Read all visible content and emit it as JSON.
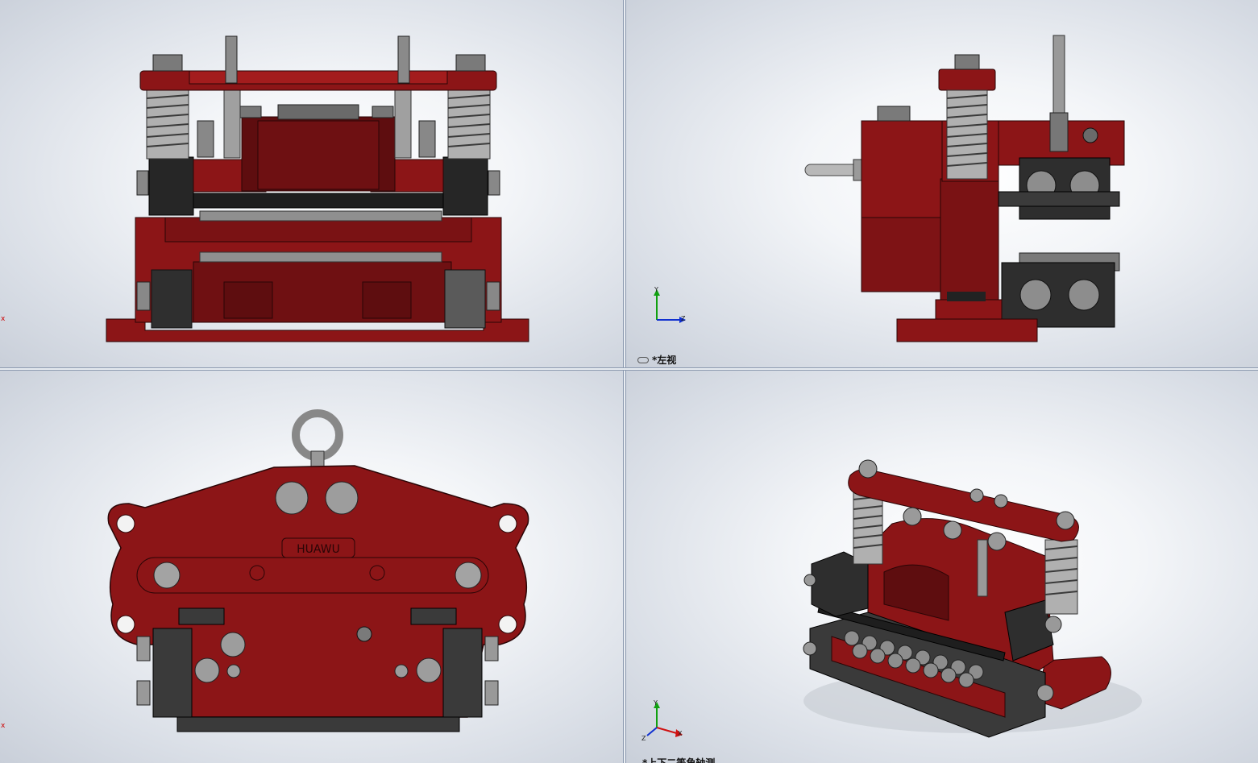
{
  "colors": {
    "part_red": "#8c1517",
    "part_red_dark": "#5e0d0f",
    "part_red_light": "#a8201f",
    "steel": "#9a9a9a",
    "steel_dark": "#4a4a4a",
    "block_dark": "#3a3a3a",
    "axis_x": "#d01010",
    "axis_y": "#10a010",
    "axis_z": "#1030d0"
  },
  "viewports": {
    "front": {
      "corner_mark": "x"
    },
    "left": {
      "view_label": "*左视",
      "label_icon": "link-icon",
      "triad": {
        "y": "Y",
        "z": "Z"
      }
    },
    "top": {
      "corner_mark": "x",
      "brand_text": "HUAWU"
    },
    "isometric": {
      "triad": {
        "y": "Y",
        "x": "X",
        "z": "Z"
      },
      "view_label": "*上下二等角轴测"
    }
  }
}
